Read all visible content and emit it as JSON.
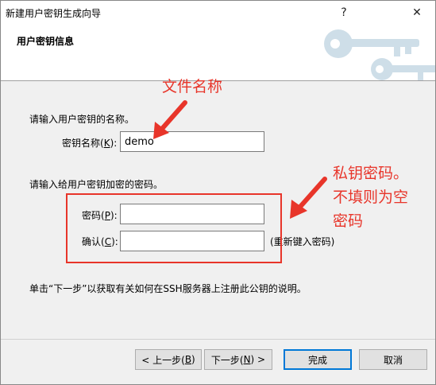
{
  "window": {
    "title": "新建用户密钥生成向导"
  },
  "titlebar": {
    "help_glyph": "?",
    "close_glyph": "✕"
  },
  "header": {
    "title": "用户密钥信息"
  },
  "form": {
    "name_prompt": "请输入用户密钥的名称。",
    "name_label": "密钥名称(",
    "name_hotkey": "K",
    "name_label_end": "):",
    "name_value": "demo",
    "pass_prompt": "请输入给用户密钥加密的密码。",
    "pass_label": "密码(",
    "pass_hotkey": "P",
    "pass_label_end": "):",
    "pass_value": "",
    "confirm_label": "确认(",
    "confirm_hotkey": "C",
    "confirm_label_end": "):",
    "confirm_value": "",
    "confirm_hint": "(重新键入密码)",
    "info_text": "单击“下一步”以获取有关如何在SSH服务器上注册此公钥的说明。"
  },
  "buttons": {
    "back_prefix": "< 上一步(",
    "back_hotkey": "B",
    "back_suffix": ")",
    "next_prefix": "下一步(",
    "next_hotkey": "N",
    "next_suffix": ") >",
    "finish": "完成",
    "cancel": "取消"
  },
  "annotations": {
    "filename_note": "文件名称",
    "password_note_line1": "私钥密码。",
    "password_note_line2": "不填则为空",
    "password_note_line3": "密码"
  },
  "colors": {
    "annotation": "#e8352a",
    "default_button_border": "#0078d7"
  }
}
